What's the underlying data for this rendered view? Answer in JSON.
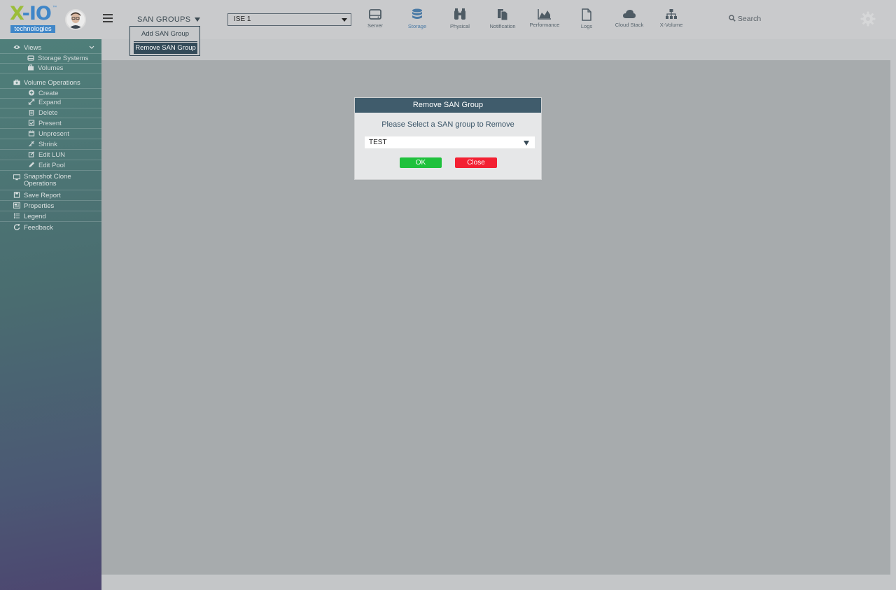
{
  "brand": {
    "logo_text": "X-IO",
    "logo_sub": "technologies",
    "tm": "TM"
  },
  "header": {
    "san_groups_label": "SAN GROUPS",
    "san_menu": {
      "add": "Add SAN Group",
      "remove": "Remove SAN Group"
    },
    "ise_select_value": "ISE 1",
    "nav": [
      {
        "label": "Server",
        "icon": "server-icon"
      },
      {
        "label": "Storage",
        "icon": "database-icon",
        "active": true
      },
      {
        "label": "Physical",
        "icon": "binoculars-icon"
      },
      {
        "label": "Notification",
        "icon": "files-icon"
      },
      {
        "label": "Performance",
        "icon": "area-chart-icon"
      },
      {
        "label": "Logs",
        "icon": "file-icon"
      },
      {
        "label": "Cloud Stack",
        "icon": "cloud-icon"
      },
      {
        "label": "X-Volume",
        "icon": "sitemap-icon"
      }
    ],
    "search_label": "Search"
  },
  "sidebar": {
    "views": "Views",
    "storage_systems": "Storage Systems",
    "volumes": "Volumes",
    "volume_operations": "Volume Operations",
    "create": "Create",
    "expand": "Expand",
    "delete": "Delete",
    "present": "Present",
    "unpresent": "Unpresent",
    "shrink": "Shrink",
    "edit_lun": "Edit LUN",
    "edit_pool": "Edit Pool",
    "snapshot_line1": "Snapshot Clone",
    "snapshot_line2": "Operations",
    "save_report": "Save Report",
    "properties": "Properties",
    "legend": "Legend",
    "feedback": "Feedback"
  },
  "modal": {
    "title": "Remove SAN Group",
    "message": "Please Select a SAN group to Remove",
    "select_value": "TEST",
    "ok": "OK",
    "close": "Close"
  },
  "colors": {
    "accent": "#405c6c",
    "ok": "#1fc13c",
    "close": "#f32032",
    "active_nav": "#4a7aa5"
  }
}
